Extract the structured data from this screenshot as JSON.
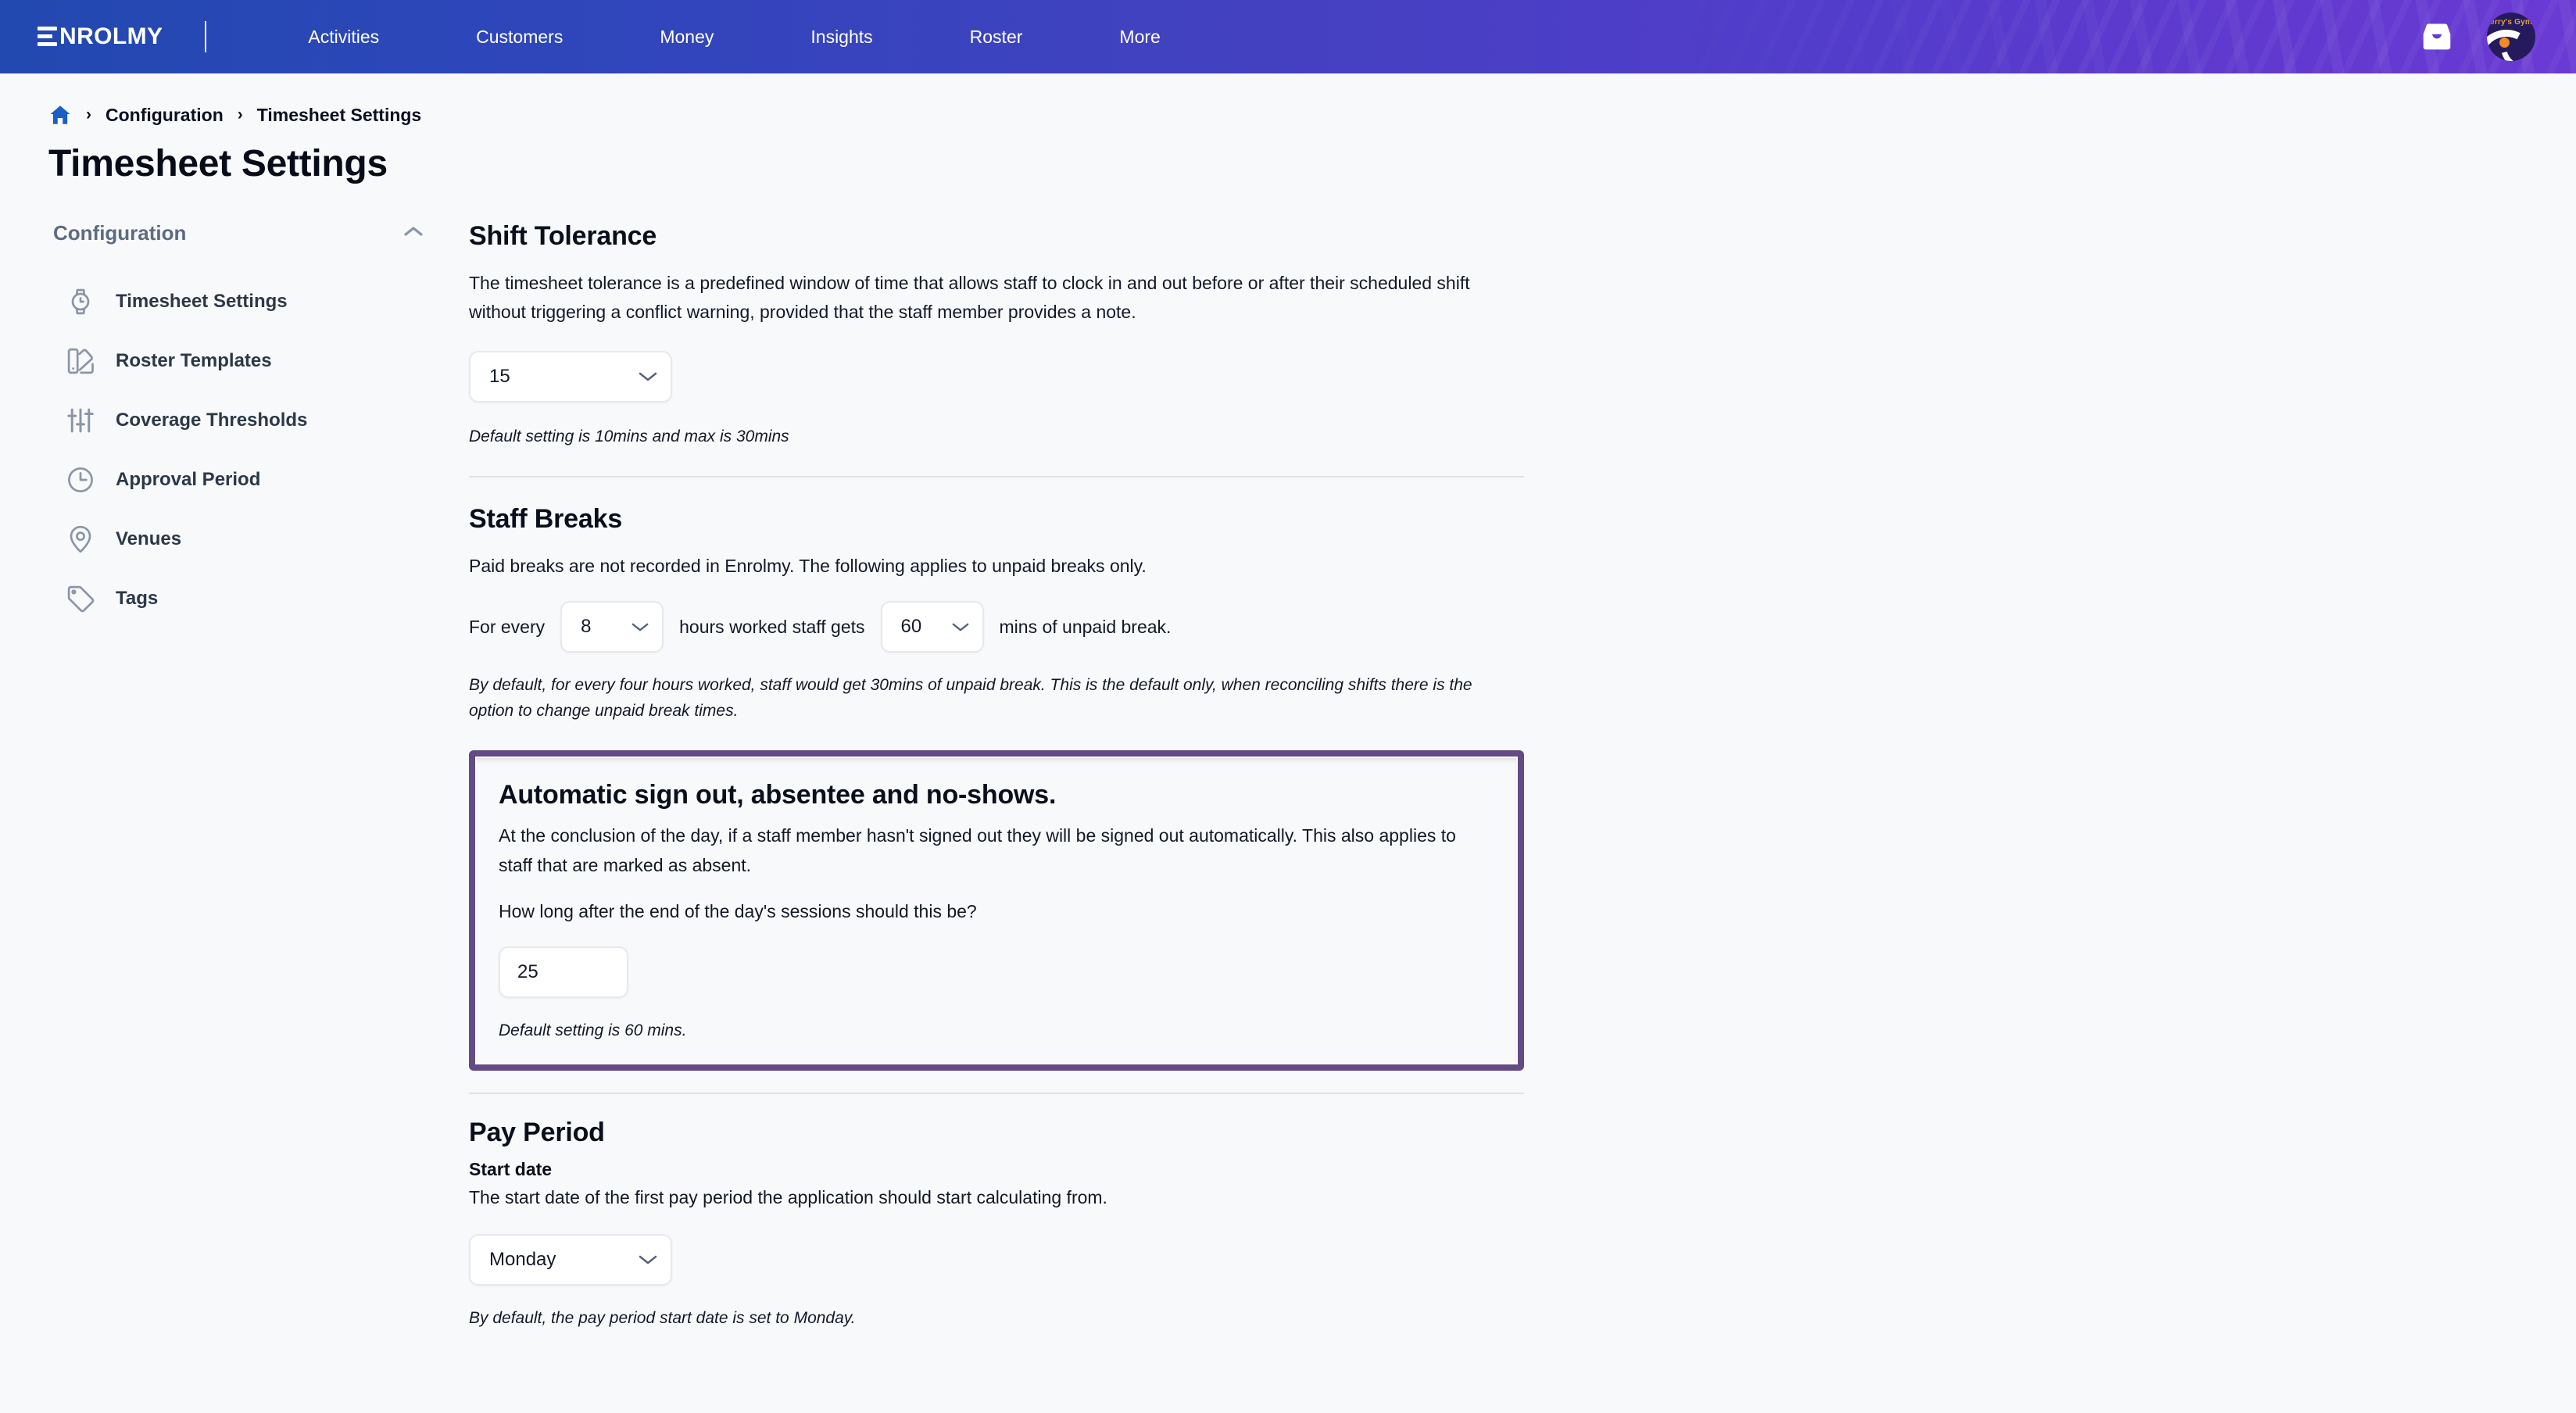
{
  "colors": {
    "nav_gradient_start": "#2249b0",
    "nav_gradient_end": "#6a3ad4",
    "highlight_border": "#644a87",
    "home_icon": "#1a5fc4",
    "sidebar_icon": "#8a95a6",
    "divider": "#dfe3e8",
    "page_bg": "#f8f9fb"
  },
  "topnav": {
    "logo_text": "NROLMY",
    "logo_icon": "enrolmy-e-logo",
    "links": [
      {
        "label": "Activities"
      },
      {
        "label": "Customers"
      },
      {
        "label": "Money"
      },
      {
        "label": "Insights"
      },
      {
        "label": "Roster"
      },
      {
        "label": "More"
      }
    ],
    "inbox_icon": "inbox-icon",
    "avatar_icon": "avatar",
    "avatar_text": "erry's Gym"
  },
  "breadcrumb": {
    "home_icon": "home-icon",
    "separator": "›",
    "items": [
      {
        "label": "Configuration"
      },
      {
        "label": "Timesheet Settings"
      }
    ]
  },
  "page": {
    "title": "Timesheet Settings"
  },
  "sidebar": {
    "group_label": "Configuration",
    "collapse_icon": "chevron-up-icon",
    "items": [
      {
        "label": "Timesheet Settings",
        "icon": "watch-icon"
      },
      {
        "label": "Roster Templates",
        "icon": "palette-swatch-icon"
      },
      {
        "label": "Coverage Thresholds",
        "icon": "sliders-icon"
      },
      {
        "label": "Approval Period",
        "icon": "clock-icon"
      },
      {
        "label": "Venues",
        "icon": "location-pin-icon"
      },
      {
        "label": "Tags",
        "icon": "tag-icon"
      }
    ]
  },
  "sections": {
    "shift_tolerance": {
      "title": "Shift Tolerance",
      "description": "The timesheet tolerance is a predefined window of time that allows staff to clock in and out before or after their scheduled shift without triggering a conflict warning, provided that the staff member provides a note.",
      "select_value": "15",
      "hint": "Default setting is 10mins and max is 30mins"
    },
    "staff_breaks": {
      "title": "Staff Breaks",
      "description": "Paid breaks are not recorded in Enrolmy. The following applies to unpaid breaks only.",
      "label_before": "For every",
      "hours_value": "8",
      "label_middle": "hours worked staff gets",
      "mins_value": "60",
      "label_after": "mins of unpaid break.",
      "hint": "By default, for every four hours worked, staff would get 30mins of unpaid break. This is the default only, when reconciling shifts there is the option to change unpaid break times."
    },
    "automatic_signout": {
      "title": "Automatic sign out, absentee and no-shows.",
      "description": "At the conclusion of the day, if a staff member hasn't signed out they will be signed out automatically. This also applies to staff that are marked as absent.",
      "question": "How long after the end of the day's sessions should this be?",
      "input_value": "25",
      "hint": "Default setting is 60 mins."
    },
    "pay_period": {
      "title": "Pay Period",
      "subtitle": "Start date",
      "description": "The start date of the first pay period the application should start calculating from.",
      "select_value": "Monday",
      "hint": "By default, the pay period start date is set to Monday."
    }
  }
}
